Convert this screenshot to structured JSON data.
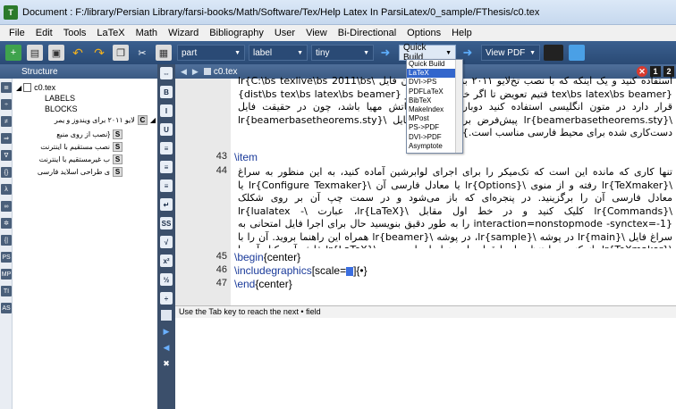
{
  "window": {
    "title": "Document : F:/library/Persian Library/farsi-books/Math/Software/Tex/Help Latex In ParsiLatex/0_sample/FThesis/c0.tex"
  },
  "menu": [
    "File",
    "Edit",
    "Tools",
    "LaTeX",
    "Math",
    "Wizard",
    "Bibliography",
    "User",
    "View",
    "Bi-Directional",
    "Options",
    "Help"
  ],
  "toolbar": {
    "part_label": "part",
    "label_label": "label",
    "size_label": "tiny",
    "quick_build": "Quick Build",
    "view_pdf": "View PDF"
  },
  "structure": {
    "header": "Structure",
    "file": "c0.tex",
    "labels": "LABELS",
    "blocks": "BLOCKS",
    "chapter": "لایو ۲۰۱۱ برای ویندوز و یمر",
    "sections": [
      "{نصب از روی منبع",
      "نصب مستقیم با اینترنت",
      "ب غیرمستقیم با اینترنت",
      "ی طراحی اسلاید فارسی"
    ]
  },
  "editor": {
    "tab_file": "c0.tex",
    "badges": [
      "1",
      "2"
    ],
    "para1": "استفاده کنید و یک اینکه که با نصب تخ‌لایو ۲۰۱۱ بر روی برای آن فایل \\lr{C:\\bs texlive\\bs 2011\\bs tex\\bs latex\\bs beamer} فتیم تعویض تا اگر خواستید از بیمر {dist\\bs tex\\bs latex\\bs beamer} قرار دارد در متون انگلیسی استفاده کنید دوباره با همان کاتش مهیا باشد، چون در حقیقت فایل \\lr{beamerbasetheorems.sty} پیش‌فرض برای لاتین و فایل \\lr{beamerbasetheorems.sty} دست‌کاری شده برای محیط فارسی مناسب است.}",
    "line43": "\\item",
    "para2": "تنها کاری که مانده این است که تک‌میکر را برای اجرای لوابرشین آماده کنید، به این منظور به سراغ \\lr{TeXmaker} رفته و از منوی \\lr{Options} یا معادل فارسی آن \\lr{Configure Texmaker} یا معادل فارسی آن را برگزینید. در پنجره‌ای که باز می‌شود و در سمت چپ آن بر روی شکلک \\lr{Commands} کلیک کنید و در خط اول مقابل \\lr{LaTeX}، عبارت \\lr{lualatex -interaction=nonstopmode -synctex=-1} را به طور دقیق بنویسید حال برای اجرا فایل امتحانی به سراغ فایل \\lr{main} در پوشه \\lr{sample}، در پوشه \\lr{beamer} همراه این راهنما بروید. آن را با \\lr{TeXmaker} باز کنید و با تنظیم اجرا قرار دادن نوار اجرا بر روی \\lr{LaTeX} فلش آبی کنار آن را برای اجرا و فلش آبی بعد از آن را برای دیدن خروجی کلیک کنید.",
    "line45": "\\begin",
    "line45_arg": "{center}",
    "line46": "\\includegraphics",
    "line46_arg1": "[scale=",
    "line46_arg2": "]{•}",
    "line47": "\\end",
    "line47_arg": "{center}",
    "line_numbers": [
      "43",
      "44",
      "45",
      "46",
      "47"
    ]
  },
  "dropdown": {
    "items": [
      "Quick Build",
      "LaTeX",
      "DVI->PS",
      "PDFLaTeX",
      "BibTeX",
      "MakeIndex",
      "MPost",
      "PS->PDF",
      "DVI->PDF",
      "Asymptote"
    ],
    "selected": "LaTeX"
  },
  "log": {
    "message": "Use the Tab key to reach the next • field"
  }
}
